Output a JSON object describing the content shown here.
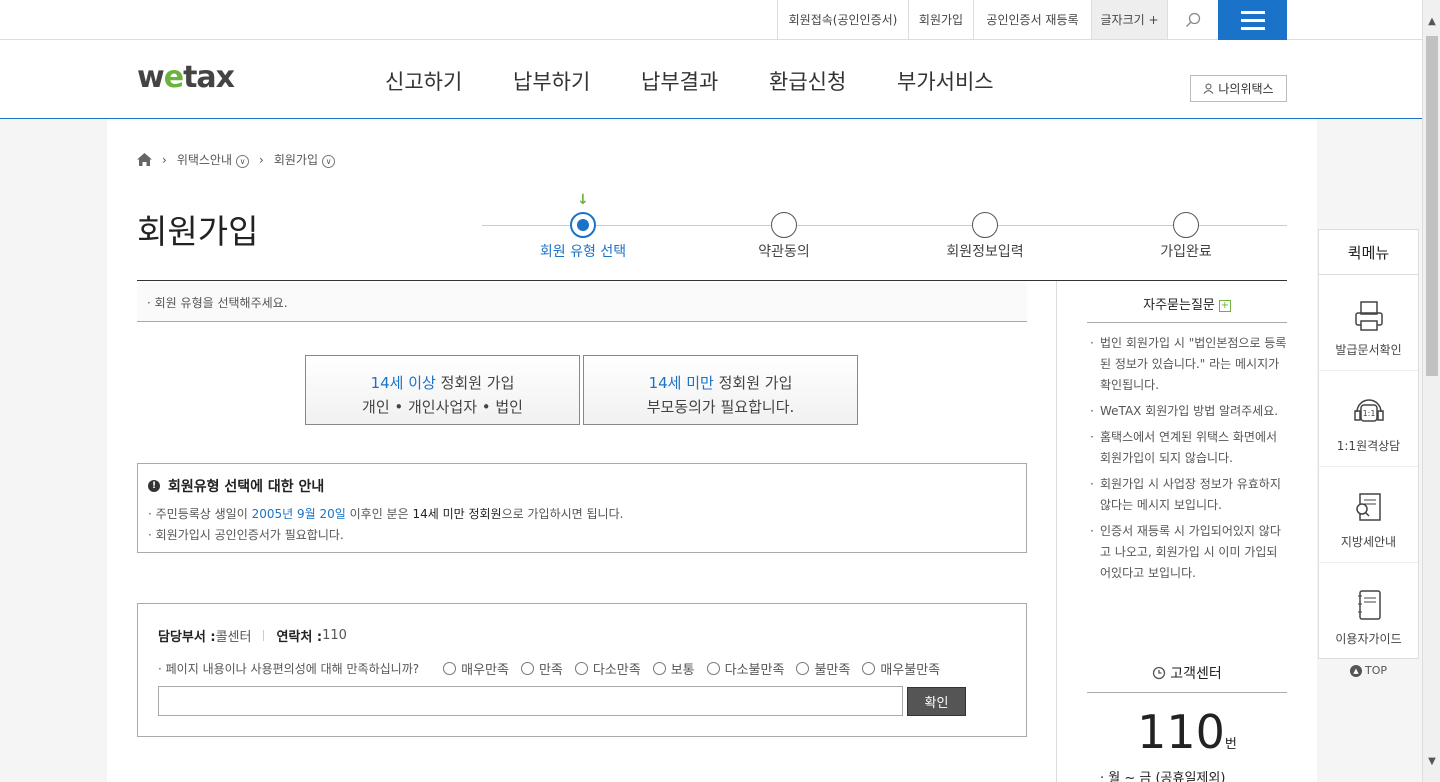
{
  "utility": {
    "cert_login": "회원접속(공인인증서)",
    "signup": "회원가입",
    "cert_register": "공인인증서 재등록",
    "font_size": "글자크기 +"
  },
  "header": {
    "logo_w": "w",
    "logo_e": "e",
    "logo_tax": "tax",
    "nav": [
      "신고하기",
      "납부하기",
      "납부결과",
      "환급신청",
      "부가서비스"
    ],
    "my_wetax": "나의위택스"
  },
  "breadcrumb": {
    "level1": "위택스안내",
    "level2": "회원가입"
  },
  "page": {
    "title": "회원가입"
  },
  "steps": [
    "회원 유형 선택",
    "약관동의",
    "회원정보입력",
    "가입완료"
  ],
  "notice": "· 회원 유형을 선택해주세요.",
  "join_options": [
    {
      "highlight": "14세 이상",
      "title": " 정회원 가입",
      "sub": "개인 • 개인사업자 • 법인"
    },
    {
      "highlight": "14세 미만",
      "title": " 정회원 가입",
      "sub": "부모동의가 필요합니다."
    }
  ],
  "guide": {
    "title": "회원유형 선택에 대한 안내",
    "line1_pre": "· 주민등록상 생일이 ",
    "line1_date": "2005년 9월 20일",
    "line1_mid": " 이후인 분은 ",
    "line1_em": "14세 미만 정회원",
    "line1_post": "으로 가입하시면 됩니다.",
    "line2": "· 회원가입시 공인인증서가 필요합니다."
  },
  "survey": {
    "dept_label": "담당부서 :",
    "dept_value": " 콜센터",
    "contact_label": "연락처 :",
    "contact_value": " 110",
    "question": "·  페이지 내용이나 사용편의성에 대해 만족하십니까?",
    "options": [
      "매우만족",
      "만족",
      "다소만족",
      "보통",
      "다소불만족",
      "불만족",
      "매우불만족"
    ],
    "submit": "확인"
  },
  "faq": {
    "title": "자주묻는질문",
    "items": [
      "법인 회원가입 시 \"법인본점으로 등록된 정보가 있습니다.\" 라는 메시지가 확인됩니다.",
      "WeTAX 회원가입 방법 알려주세요.",
      "홈택스에서 연계된 위택스 화면에서 회원가입이 되지 않습니다.",
      "회원가입 시 사업장 정보가 유효하지않다는 메시지 보입니다.",
      "인증서 재등록 시 가입되어있지 않다고 나오고, 회원가입 시 이미 가입되어있다고 보입니다."
    ]
  },
  "customer_center": {
    "title": "고객센터",
    "number": "110",
    "unit": "번",
    "hours": "· 월 ~ 금 (공휴일제외)"
  },
  "quick_menu": {
    "title": "퀵메뉴",
    "items": [
      "발급문서확인",
      "1:1원격상담",
      "지방세안내",
      "이용자가이드"
    ],
    "consult_badge": "1:1",
    "top": "TOP"
  },
  "colors": {
    "accent": "#1a73c8",
    "green": "#6bb33c"
  }
}
